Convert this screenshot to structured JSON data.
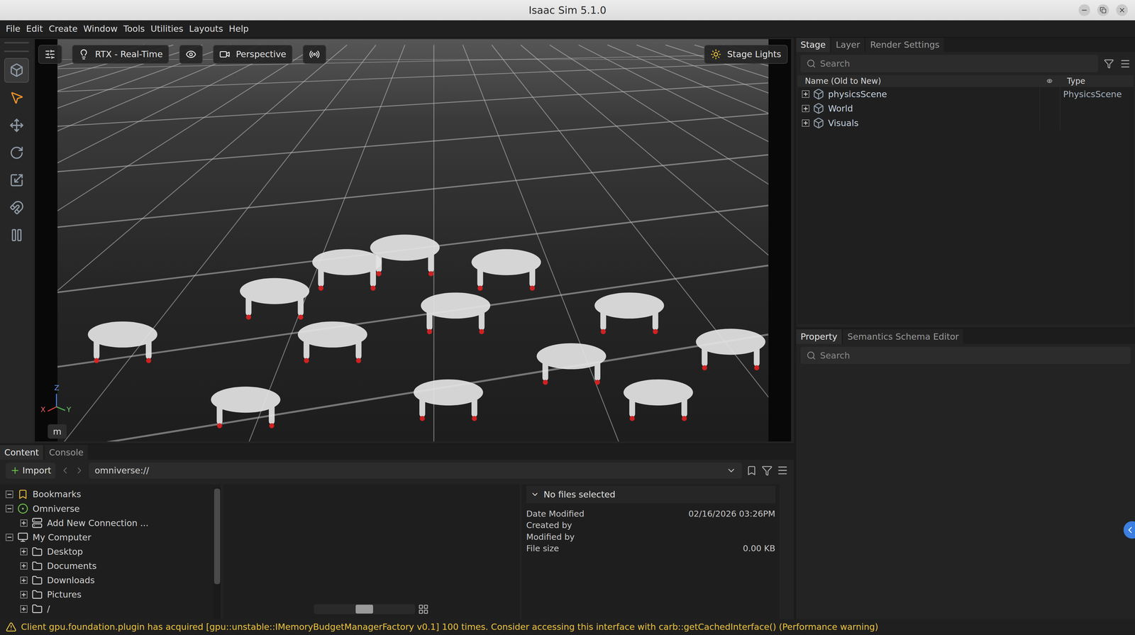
{
  "window": {
    "title": "Isaac Sim 5.1.0"
  },
  "menu": [
    "File",
    "Edit",
    "Create",
    "Window",
    "Tools",
    "Utilities",
    "Layouts",
    "Help"
  ],
  "tools": [
    {
      "kind": "mode",
      "selected": false
    },
    {
      "kind": "select",
      "selected": true
    },
    {
      "kind": "move",
      "selected": false
    },
    {
      "kind": "rotate",
      "selected": false
    },
    {
      "kind": "scale",
      "selected": false
    },
    {
      "kind": "snap",
      "selected": false
    },
    {
      "kind": "pause",
      "selected": false
    }
  ],
  "viewport": {
    "renderer": "RTX - Real-Time",
    "camera": "Perspective",
    "lights": "Stage Lights",
    "axes": {
      "z": "Z",
      "x": "X",
      "y": "Y"
    },
    "unit": "m"
  },
  "stage": {
    "tabs": [
      {
        "label": "Stage",
        "selected": true
      },
      {
        "label": "Layer",
        "selected": false
      },
      {
        "label": "Render Settings",
        "selected": false
      }
    ],
    "search": {
      "placeholder": "Search"
    },
    "columns": [
      "Name (Old to New)",
      "Type"
    ],
    "rows": [
      {
        "name": "physicsScene",
        "type": "PhysicsScene",
        "expanded": false
      },
      {
        "name": "World",
        "type": "",
        "expanded": false
      },
      {
        "name": "Visuals",
        "type": "",
        "expanded": false
      }
    ]
  },
  "property": {
    "tabs": [
      {
        "label": "Property",
        "selected": true
      },
      {
        "label": "Semantics Schema Editor",
        "selected": false
      }
    ],
    "search": {
      "placeholder": "Search"
    }
  },
  "content": {
    "tabs": [
      {
        "label": "Content",
        "selected": true
      },
      {
        "label": "Console",
        "selected": false
      }
    ],
    "import": "Import",
    "path": "omniverse://",
    "tree": [
      {
        "label": "Bookmarks",
        "kind": "bookmark",
        "depth": 0,
        "expanded": true
      },
      {
        "label": "Omniverse",
        "kind": "omniverse",
        "depth": 0,
        "expanded": true
      },
      {
        "label": "Add New Connection ...",
        "kind": "connection",
        "depth": 1,
        "expanded": false
      },
      {
        "label": "My Computer",
        "kind": "computer",
        "depth": 0,
        "expanded": true
      },
      {
        "label": "Desktop",
        "kind": "folder",
        "depth": 1,
        "expanded": false
      },
      {
        "label": "Documents",
        "kind": "folder",
        "depth": 1,
        "expanded": false
      },
      {
        "label": "Downloads",
        "kind": "folder",
        "depth": 1,
        "expanded": false
      },
      {
        "label": "Pictures",
        "kind": "folder",
        "depth": 1,
        "expanded": false
      },
      {
        "label": "/",
        "kind": "folder",
        "depth": 1,
        "expanded": false
      }
    ],
    "details": {
      "title": "No files selected",
      "expanded": true,
      "fields": [
        {
          "label": "Date Modified",
          "value": "02/16/2026 03:26PM"
        },
        {
          "label": "Created by",
          "value": ""
        },
        {
          "label": "Modified by",
          "value": ""
        },
        {
          "label": "File size",
          "value": "0.00 KB"
        }
      ]
    }
  },
  "status": {
    "message": "Client gpu.foundation.plugin has acquired [gpu::unstable::IMemoryBudgetManagerFactory v0.1] 100 times. Consider accessing this interface with carb::getCachedInterface() (Performance warning)"
  }
}
